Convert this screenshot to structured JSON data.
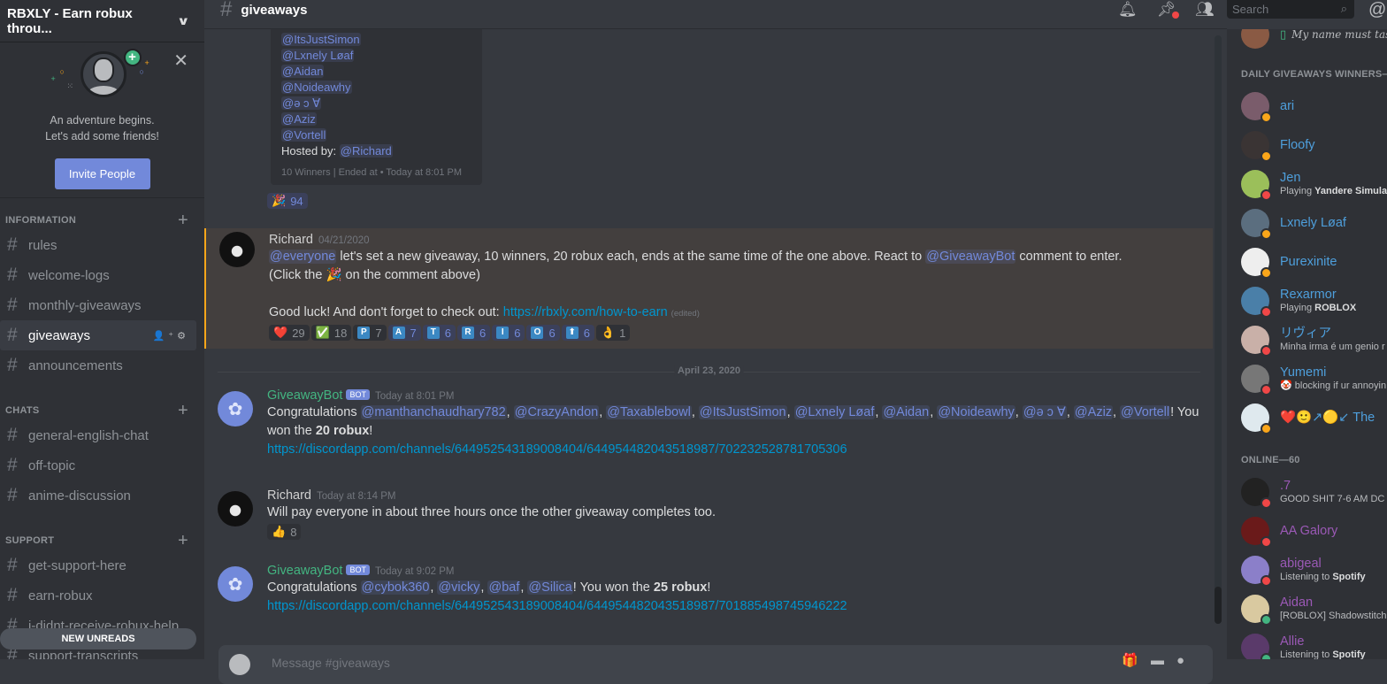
{
  "server": {
    "name": "RBXLY - Earn robux throu...",
    "chevron_icon": "chevron-down-icon"
  },
  "invite": {
    "line1": "An adventure begins.",
    "line2": "Let's add some friends!",
    "button": "Invite People",
    "close_icon": "close-icon"
  },
  "categories": [
    {
      "name": "INFORMATION",
      "channels": [
        "rules",
        "welcome-logs",
        "monthly-giveaways",
        "giveaways",
        "announcements"
      ]
    },
    {
      "name": "CHATS",
      "channels": [
        "general-english-chat",
        "off-topic",
        "anime-discussion"
      ]
    },
    {
      "name": "SUPPORT",
      "channels": [
        "get-support-here",
        "earn-robux",
        "i-didnt-receive-robux-help",
        "support-transcripts"
      ]
    }
  ],
  "active_channel": "giveaways",
  "new_unreads": "NEW UNREADS",
  "header": {
    "channel": "giveaways",
    "search_placeholder": "Search"
  },
  "embed": {
    "winners": [
      "@ItsJustSimon",
      "@Lxnely Løaf",
      "@Aidan",
      "@Noideawhy",
      "@ə ɔ Ɐ",
      "@Aziz",
      "@Vortell"
    ],
    "hosted_label": "Hosted by:",
    "host": "@Richard",
    "footer": "10 Winners | Ended at",
    "footer_time": "Today at 8:01 PM",
    "reaction": {
      "emoji": "🎉",
      "count": "94"
    }
  },
  "messages": [
    {
      "author": "Richard",
      "timestamp": "04/21/2020",
      "mention": "@everyone",
      "text1": " let's set a new giveaway, 10 winners, 20 robux each, ends at the same time of the one above. React to ",
      "mention2": "@GiveawayBot",
      "text2": " comment to enter.",
      "line2a": "(Click the ",
      "line2emoji": "🎉",
      "line2b": " on the comment above)",
      "line3": "Good luck! And don't forget to check out: ",
      "link": "https://rbxly.com/how-to-earn",
      "edited": "(edited)",
      "reactions": [
        {
          "emoji": "❤️",
          "count": "29"
        },
        {
          "emoji": "✅",
          "count": "18"
        },
        {
          "letter": "P",
          "count": "7"
        },
        {
          "letter": "A",
          "count": "7",
          "me": true
        },
        {
          "letter": "T",
          "count": "6",
          "me": true
        },
        {
          "letter": "R",
          "count": "6",
          "me": true
        },
        {
          "letter": "I",
          "count": "6",
          "me": true
        },
        {
          "letter": "O",
          "count": "6",
          "me": true
        },
        {
          "letter": "⬆",
          "count": "6",
          "me": true
        },
        {
          "emoji": "👌",
          "count": "1"
        }
      ]
    },
    {
      "author": "GiveawayBot",
      "bot_tag": "BOT",
      "timestamp": "Today at 8:01 PM",
      "prefix": "Congratulations ",
      "mentions": [
        "@manthanchaudhary782",
        "@CrazyAndon",
        "@Taxablebowl",
        "@ItsJustSimon",
        "@Lxnely Løaf",
        "@Aidan",
        "@Noideawhy",
        "@ə ɔ Ɐ",
        "@Aziz",
        "@Vortell"
      ],
      "won_text": "! You won the ",
      "prize": "20 robux",
      "end": "!",
      "link": "https://discordapp.com/channels/644952543189008404/644954482043518987/702232528781705306"
    },
    {
      "author": "Richard",
      "timestamp": "Today at 8:14 PM",
      "text": "Will pay everyone in about three hours once the other giveaway completes too.",
      "reactions": [
        {
          "emoji": "👍",
          "count": "8"
        }
      ]
    },
    {
      "author": "GiveawayBot",
      "bot_tag": "BOT",
      "timestamp": "Today at 9:02 PM",
      "prefix": "Congratulations ",
      "mentions": [
        "@cybok360",
        "@vicky",
        "@baf",
        "@Silica"
      ],
      "won_text": "! You won the ",
      "prize": "25 robux",
      "end": "!",
      "link": "https://discordapp.com/channels/644952543189008404/644954482043518987/701885498745946222"
    }
  ],
  "date_divider": "April 23, 2020",
  "composer_placeholder": "Message #giveaways",
  "members": {
    "top_partial": {
      "activity": "My name must taste goo"
    },
    "groups": [
      {
        "title": "DAILY GIVEAWAYS WINNERS—",
        "users": [
          {
            "name": "ari",
            "status": "idle"
          },
          {
            "name": "Floofy",
            "status": "idle"
          },
          {
            "name": "Jen",
            "status": "dnd",
            "activity_prefix": "Playing ",
            "activity_bold": "Yandere Simulat"
          },
          {
            "name": "Lxnely Løaf",
            "status": "idle"
          },
          {
            "name": "Purexinite",
            "status": "idle"
          },
          {
            "name": "Rexarmor",
            "status": "dnd",
            "activity_prefix": "Playing ",
            "activity_bold": "ROBLOX"
          },
          {
            "name": "リヴィア",
            "status": "dnd",
            "activity_prefix": "Minha irma é um genio r",
            "activity_bold": ""
          },
          {
            "name": "Yumemi",
            "status": "dnd",
            "activity_prefix": "🤡 blocking if ur annoyin",
            "activity_bold": ""
          },
          {
            "name": "❤️🙂↗🟡↙ The",
            "status": "idle"
          }
        ]
      },
      {
        "title": "ONLINE—60",
        "users": [
          {
            "name": ".7",
            "status": "dnd",
            "activity_prefix": "GOOD SHIT 7-6 AM DC",
            "activity_bold": ""
          },
          {
            "name": "AA Galory",
            "status": "dnd"
          },
          {
            "name": "abigeal",
            "status": "dnd",
            "activity_prefix": "Listening to ",
            "activity_bold": "Spotify"
          },
          {
            "name": "Aidan",
            "status": "online",
            "activity_prefix": "[ROBLOX] Shadowstitch",
            "activity_bold": ""
          },
          {
            "name": "Allie",
            "status": "online",
            "activity_prefix": "Listening to ",
            "activity_bold": "Spotify"
          }
        ]
      }
    ]
  }
}
